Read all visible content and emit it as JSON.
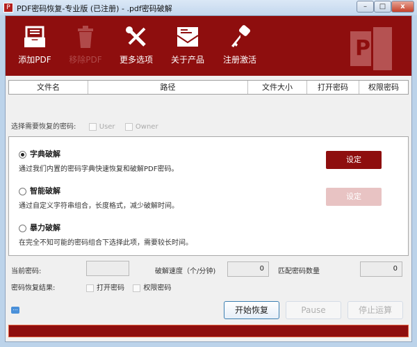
{
  "window": {
    "title": "PDF密码恢复-专业版 (已注册) - .pdf密码破解",
    "minimize": "–",
    "maximize": "□",
    "close": "x"
  },
  "toolbar": {
    "items": [
      {
        "label": "添加PDF",
        "icon": "inbox-icon",
        "enabled": true
      },
      {
        "label": "移除PDF",
        "icon": "trash-icon",
        "enabled": false
      },
      {
        "label": "更多选项",
        "icon": "tools-icon",
        "enabled": true
      },
      {
        "label": "关于产品",
        "icon": "envelope-icon",
        "enabled": true
      },
      {
        "label": "注册激活",
        "icon": "key-icon",
        "enabled": true
      }
    ],
    "logo_letter": "P"
  },
  "table": {
    "columns": [
      "文件名",
      "路径",
      "文件大小",
      "打开密码",
      "权限密码"
    ]
  },
  "choose": {
    "label": "选择需要恢复的密码:",
    "user": "User",
    "owner": "Owner"
  },
  "modes": [
    {
      "title": "字典破解",
      "desc": "通过我们内置的密码字典快速恢复和破解PDF密码。",
      "selected": true,
      "button": "设定"
    },
    {
      "title": "智能破解",
      "desc": "通过自定义字符串组合，长度格式，减少破解时间。",
      "selected": false,
      "button": "设定"
    },
    {
      "title": "暴力破解",
      "desc": "在完全不知可能的密码组合下选择此项，需要较长时间。",
      "selected": false
    }
  ],
  "stats": {
    "current_label": "当前密码:",
    "current_value": "",
    "speed_label": "破解速度（个/分钟)",
    "speed_value": "0",
    "match_label": "匹配密码数量",
    "match_value": "0"
  },
  "result": {
    "label": "密码恢复结果:",
    "open": "打开密码",
    "perm": "权限密码"
  },
  "buttons": {
    "start": "开始恢复",
    "pause": "Pause",
    "stop": "停止运算"
  },
  "progress": 1.0,
  "colors": {
    "brand": "#8e0e0e"
  }
}
